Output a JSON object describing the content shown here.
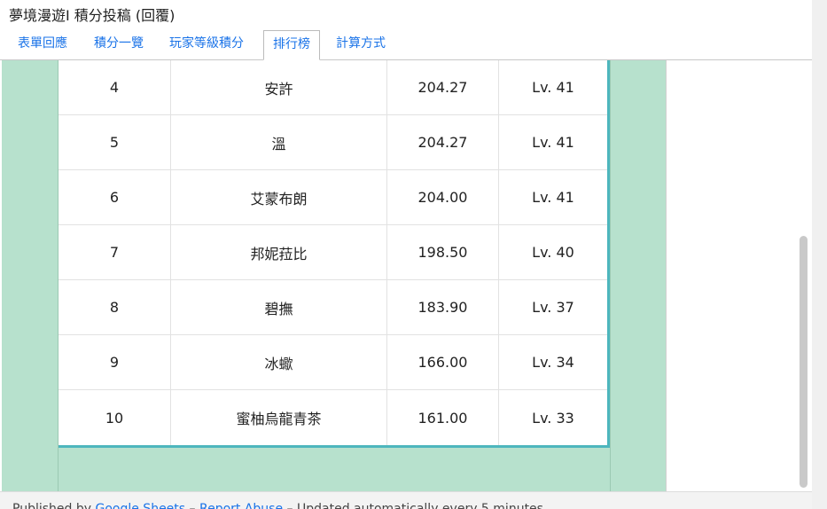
{
  "doc_title": "夢境漫遊I 積分投稿 (回覆)",
  "tabs": [
    {
      "label": "表單回應"
    },
    {
      "label": "積分一覽"
    },
    {
      "label": "玩家等級積分"
    },
    {
      "label": "排行榜"
    },
    {
      "label": "計算方式"
    }
  ],
  "active_tab": "排行榜",
  "rows": [
    {
      "rank": "4",
      "name": "安許",
      "score": "204.27",
      "level": "Lv. 41"
    },
    {
      "rank": "5",
      "name": "溫",
      "score": "204.27",
      "level": "Lv. 41"
    },
    {
      "rank": "6",
      "name": "艾蒙布朗",
      "score": "204.00",
      "level": "Lv. 41"
    },
    {
      "rank": "7",
      "name": "邦妮菈比",
      "score": "198.50",
      "level": "Lv. 40"
    },
    {
      "rank": "8",
      "name": "碧撫",
      "score": "183.90",
      "level": "Lv. 37"
    },
    {
      "rank": "9",
      "name": "冰蠍",
      "score": "166.00",
      "level": "Lv. 34"
    },
    {
      "rank": "10",
      "name": "蜜柚烏龍青茶",
      "score": "161.00",
      "level": "Lv. 33"
    }
  ],
  "footer": {
    "published_by": "Published by",
    "google_sheets": "Google Sheets",
    "separator": "–",
    "report_abuse": "Report Abuse",
    "updated": "Updated automatically every 5 minutes"
  },
  "colors": {
    "band": "#b7e1cd",
    "table_border": "#4db6bd",
    "link": "#1a73e8"
  }
}
